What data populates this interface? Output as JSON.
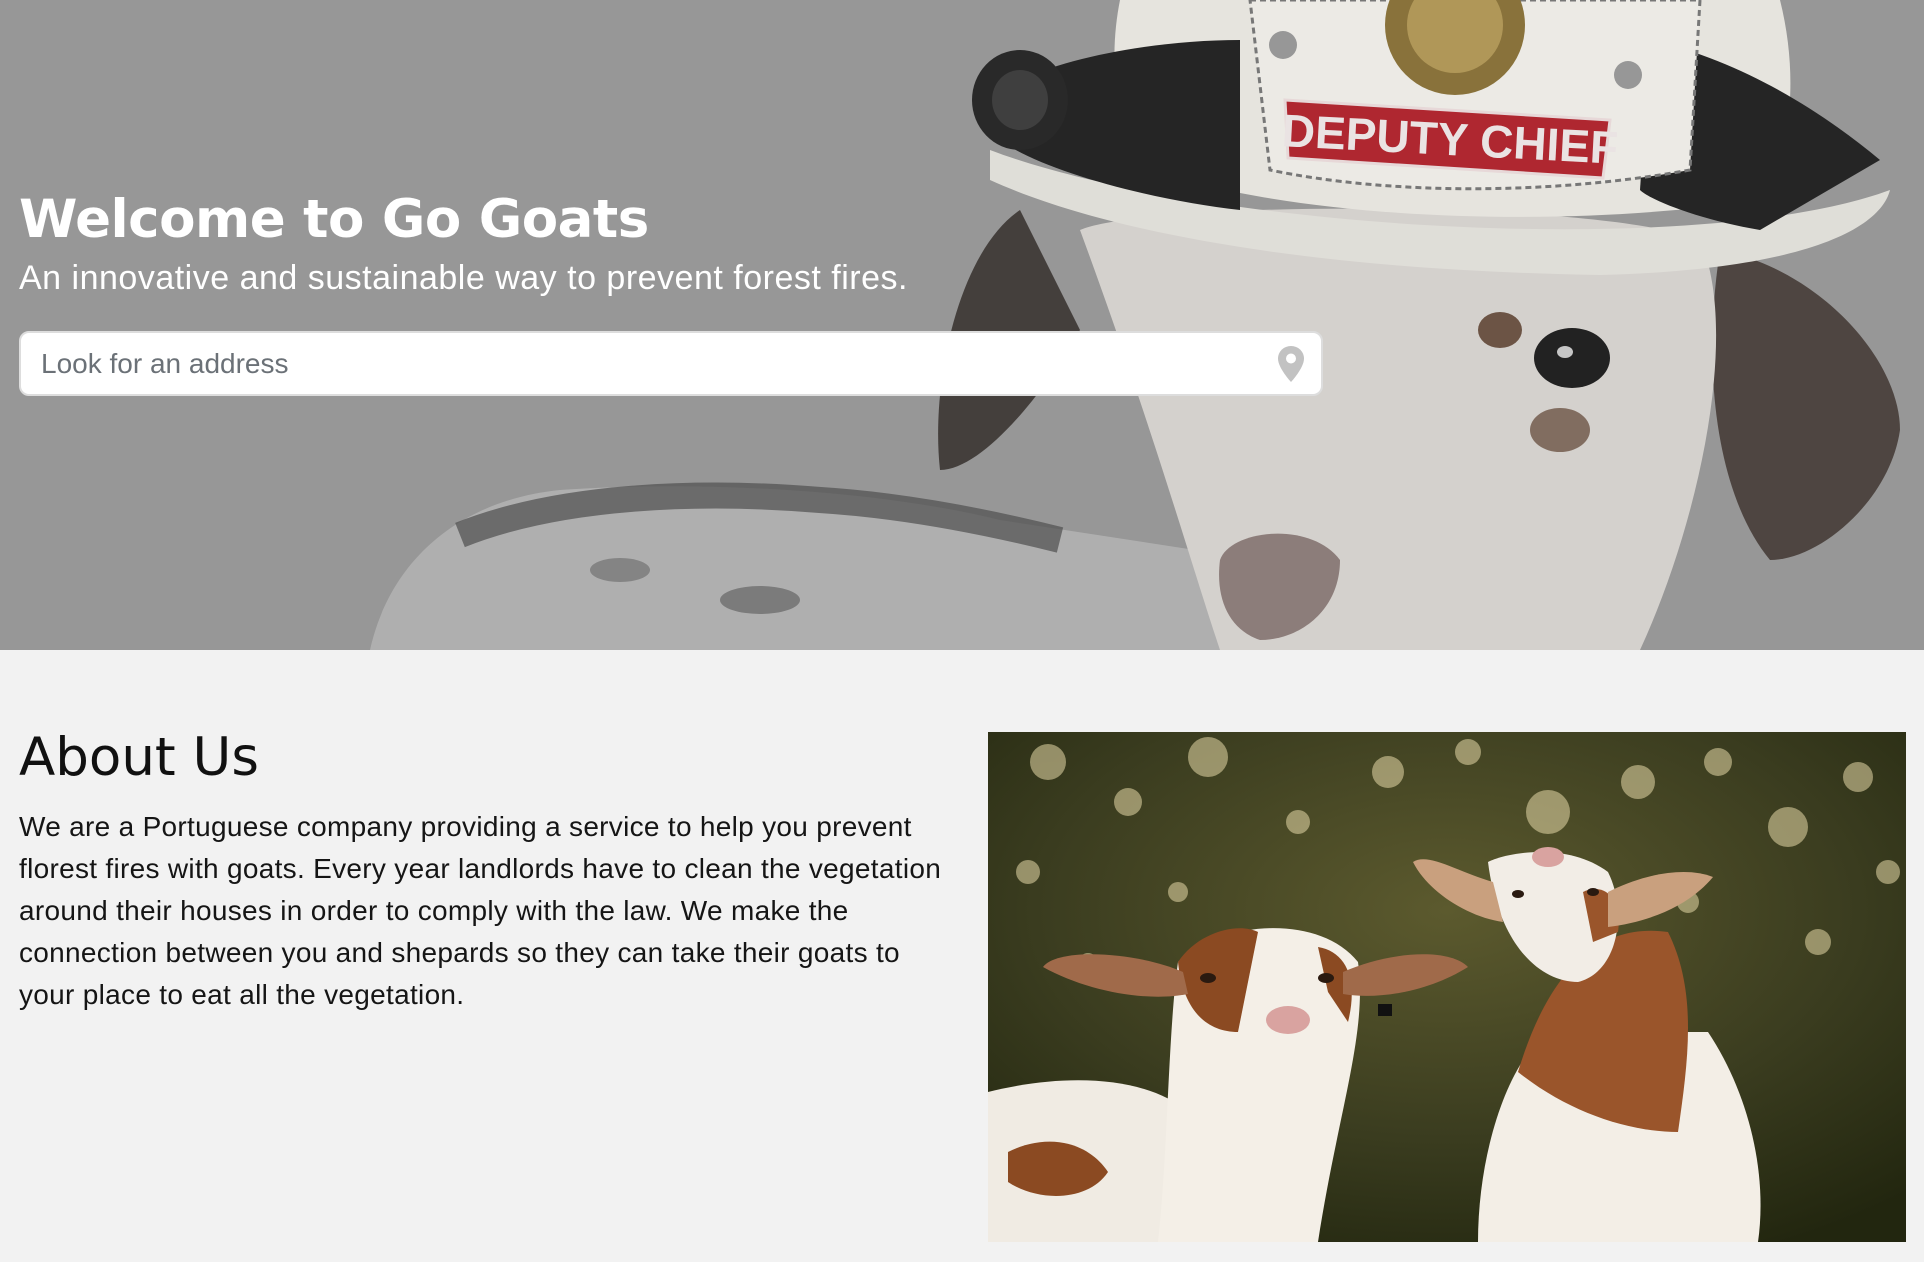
{
  "hero": {
    "title": "Welcome to Go Goats",
    "subtitle": "An innovative and sustainable way to prevent forest fires.",
    "search_placeholder": "Look for an address",
    "helmet_badge": "DEPUTY CHIEF"
  },
  "about": {
    "title": "About Us",
    "body": "We are a Portuguese company providing a service to help you prevent florest fires with goats. Every year landlords have to clean the vegetation around their houses in order to comply with the law. We make the connection between you and shepards so they can take their goats to your place to eat all the vegetation."
  },
  "colors": {
    "hero_overlay": "#999999",
    "page_background": "#f2f2f2",
    "badge_red": "#b3202a"
  },
  "icons": {
    "search_pin": "map-pin-icon"
  }
}
